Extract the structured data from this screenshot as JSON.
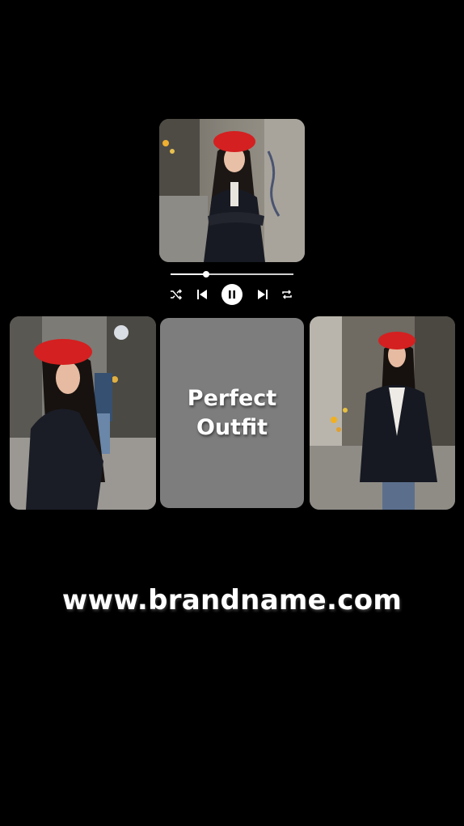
{
  "player": {
    "progress_fraction": 0.29,
    "controls": [
      "shuffle-icon",
      "previous-icon",
      "pause-icon",
      "next-icon",
      "repeat-icon"
    ]
  },
  "collage": {
    "center_text": "Perfect\nOutfit",
    "center_bg": "#7d7d7d"
  },
  "footer": {
    "website": "www.brandname.com"
  },
  "colors": {
    "background": "#000000",
    "accent_beret": "#d42020"
  }
}
